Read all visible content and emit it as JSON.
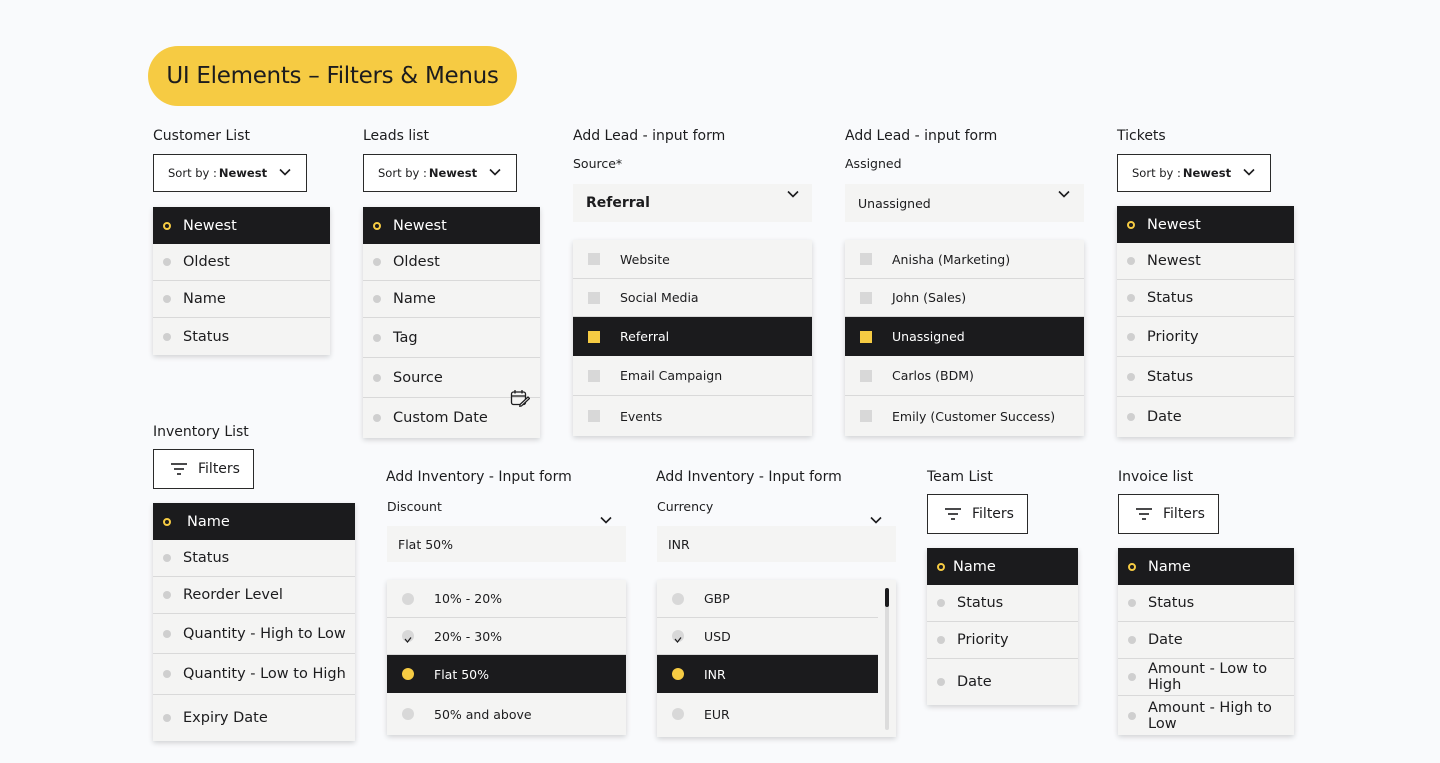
{
  "page_title": "UI Elements – Filters & Menus",
  "customer_list": {
    "title": "Customer List",
    "sort_prefix": "Sort by : ",
    "sort_value": "Newest",
    "items": [
      "Newest",
      "Oldest",
      "Name",
      "Status"
    ]
  },
  "leads_list": {
    "title": "Leads list",
    "sort_prefix": "Sort by : ",
    "sort_value": "Newest",
    "items": [
      "Newest",
      "Oldest",
      "Name",
      "Tag",
      "Source",
      "Custom Date"
    ]
  },
  "add_lead_source": {
    "title": "Add Lead - input form",
    "label": "Source*",
    "value": "Referral",
    "options": [
      "Website",
      "Social Media",
      "Referral",
      "Email Campaign",
      "Events"
    ]
  },
  "add_lead_assigned": {
    "title": "Add Lead - input form",
    "label": "Assigned",
    "value": "Unassigned",
    "options": [
      "Anisha (Marketing)",
      "John (Sales)",
      "Unassigned",
      "Carlos (BDM)",
      "Emily (Customer Success)"
    ]
  },
  "tickets": {
    "title": "Tickets",
    "sort_prefix": "Sort by : ",
    "sort_value": "Newest",
    "items": [
      "Newest",
      "Newest",
      "Status",
      "Priority",
      "Status",
      "Date"
    ]
  },
  "inventory_list": {
    "title": "Inventory List",
    "filter_label": "Filters",
    "items": [
      "Name",
      "Status",
      "Reorder Level",
      "Quantity - High to Low",
      "Quantity - Low to High",
      "Expiry Date"
    ]
  },
  "add_inventory_discount": {
    "title": "Add Inventory - Input form",
    "label": "Discount",
    "value": "Flat 50%",
    "options": [
      "10% - 20%",
      "20% - 30%",
      "Flat 50%",
      "50% and above"
    ]
  },
  "add_inventory_currency": {
    "title": "Add Inventory - Input form",
    "label": "Currency",
    "value": "INR",
    "options": [
      "GBP",
      "USD",
      "INR",
      "EUR"
    ]
  },
  "team_list": {
    "title": "Team List",
    "filter_label": "Filters",
    "items": [
      "Name",
      "Status",
      "Priority",
      "Date"
    ]
  },
  "invoice_list": {
    "title": "Invoice list",
    "filter_label": "Filters",
    "items": [
      "Name",
      "Status",
      "Date",
      "Amount  - Low to High",
      "Amount  - High to Low"
    ]
  },
  "colors": {
    "accent": "#f6cb43",
    "dark": "#1b1b1d",
    "menu_bg": "#f4f4f3",
    "page_bg": "#f9fafc"
  }
}
